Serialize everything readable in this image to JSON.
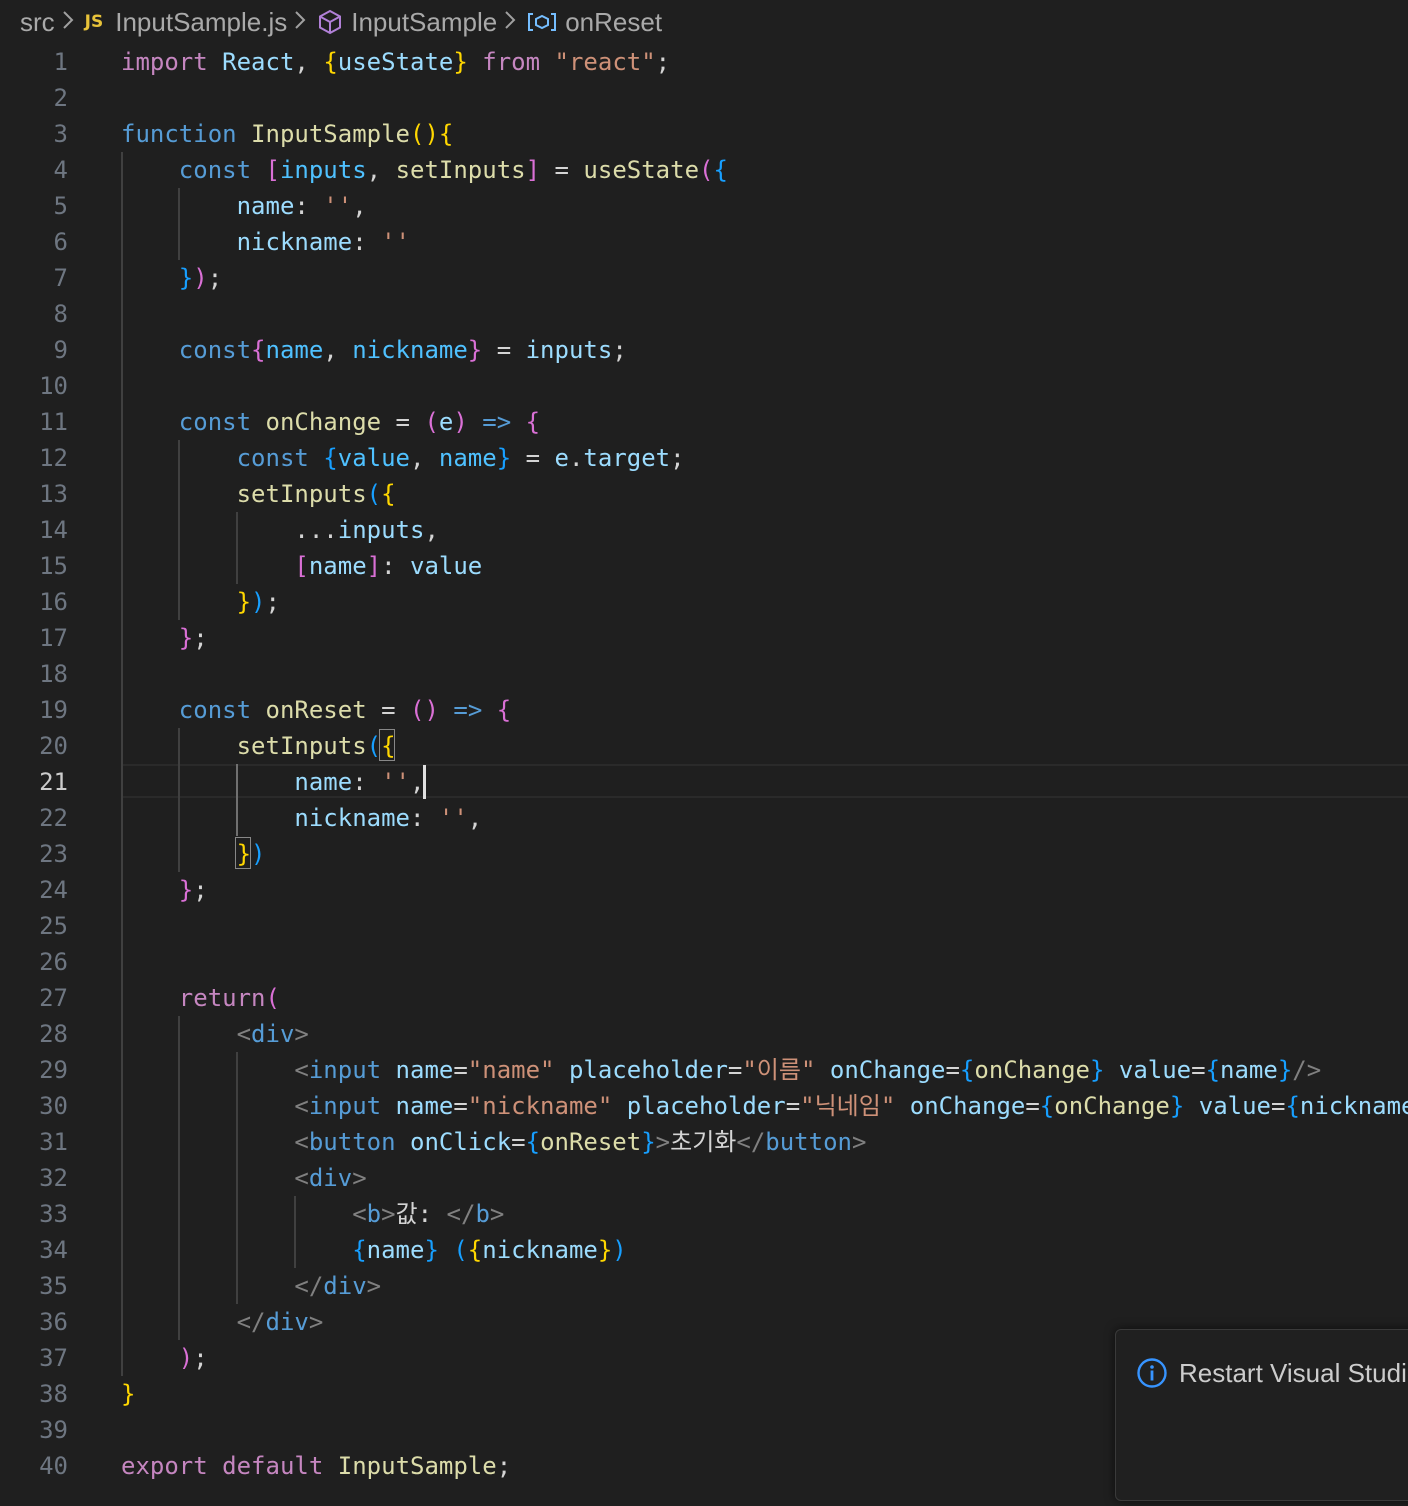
{
  "breadcrumb": {
    "folder": "src",
    "file_badge": "JS",
    "file": "InputSample.js",
    "component": "InputSample",
    "symbol": "onReset",
    "separator": ">"
  },
  "editor": {
    "active_line": 21,
    "lines": [
      [
        [
          "kc",
          "import"
        ],
        [
          "pn",
          " "
        ],
        [
          "vr",
          "React"
        ],
        [
          "pn",
          ", "
        ],
        [
          "b1",
          "{"
        ],
        [
          "vr",
          "useState"
        ],
        [
          "b1",
          "}"
        ],
        [
          "pn",
          " "
        ],
        [
          "kc",
          "from"
        ],
        [
          "pn",
          " "
        ],
        [
          "st",
          "\"react\""
        ],
        [
          "pn",
          ";"
        ]
      ],
      [],
      [
        [
          "kw",
          "function"
        ],
        [
          "pn",
          " "
        ],
        [
          "fn",
          "InputSample"
        ],
        [
          "b1",
          "()"
        ],
        [
          "b1",
          "{"
        ]
      ],
      [
        [
          "pn",
          "    "
        ],
        [
          "kw",
          "const"
        ],
        [
          "pn",
          " "
        ],
        [
          "b2",
          "["
        ],
        [
          "cn",
          "inputs"
        ],
        [
          "pn",
          ", "
        ],
        [
          "fn",
          "setInputs"
        ],
        [
          "b2",
          "]"
        ],
        [
          "pn",
          " = "
        ],
        [
          "fn",
          "useState"
        ],
        [
          "b2",
          "("
        ],
        [
          "b3",
          "{"
        ]
      ],
      [
        [
          "pn",
          "        "
        ],
        [
          "vr",
          "name"
        ],
        [
          "pn",
          ": "
        ],
        [
          "st",
          "''"
        ],
        [
          "pn",
          ","
        ]
      ],
      [
        [
          "pn",
          "        "
        ],
        [
          "vr",
          "nickname"
        ],
        [
          "pn",
          ": "
        ],
        [
          "st",
          "''"
        ]
      ],
      [
        [
          "pn",
          "    "
        ],
        [
          "b3",
          "}"
        ],
        [
          "b2",
          ")"
        ],
        [
          "pn",
          ";"
        ]
      ],
      [],
      [
        [
          "pn",
          "    "
        ],
        [
          "kw",
          "const"
        ],
        [
          "b2",
          "{"
        ],
        [
          "cn",
          "name"
        ],
        [
          "pn",
          ", "
        ],
        [
          "cn",
          "nickname"
        ],
        [
          "b2",
          "}"
        ],
        [
          "pn",
          " = "
        ],
        [
          "vr",
          "inputs"
        ],
        [
          "pn",
          ";"
        ]
      ],
      [],
      [
        [
          "pn",
          "    "
        ],
        [
          "kw",
          "const"
        ],
        [
          "pn",
          " "
        ],
        [
          "fn",
          "onChange"
        ],
        [
          "pn",
          " = "
        ],
        [
          "b2",
          "("
        ],
        [
          "vr",
          "e"
        ],
        [
          "b2",
          ")"
        ],
        [
          "pn",
          " "
        ],
        [
          "kw",
          "=>"
        ],
        [
          "pn",
          " "
        ],
        [
          "b2",
          "{"
        ]
      ],
      [
        [
          "pn",
          "        "
        ],
        [
          "kw",
          "const"
        ],
        [
          "pn",
          " "
        ],
        [
          "b3",
          "{"
        ],
        [
          "cn",
          "value"
        ],
        [
          "pn",
          ", "
        ],
        [
          "cn",
          "name"
        ],
        [
          "b3",
          "}"
        ],
        [
          "pn",
          " = "
        ],
        [
          "vr",
          "e"
        ],
        [
          "pn",
          "."
        ],
        [
          "vr",
          "target"
        ],
        [
          "pn",
          ";"
        ]
      ],
      [
        [
          "pn",
          "        "
        ],
        [
          "fn",
          "setInputs"
        ],
        [
          "b3",
          "("
        ],
        [
          "b1",
          "{"
        ]
      ],
      [
        [
          "pn",
          "            ..."
        ],
        [
          "vr",
          "inputs"
        ],
        [
          "pn",
          ","
        ]
      ],
      [
        [
          "pn",
          "            "
        ],
        [
          "b2",
          "["
        ],
        [
          "vr",
          "name"
        ],
        [
          "b2",
          "]"
        ],
        [
          "pn",
          ": "
        ],
        [
          "vr",
          "value"
        ]
      ],
      [
        [
          "pn",
          "        "
        ],
        [
          "b1",
          "}"
        ],
        [
          "b3",
          ")"
        ],
        [
          "pn",
          ";"
        ]
      ],
      [
        [
          "pn",
          "    "
        ],
        [
          "b2",
          "}"
        ],
        [
          "pn",
          ";"
        ]
      ],
      [],
      [
        [
          "pn",
          "    "
        ],
        [
          "kw",
          "const"
        ],
        [
          "pn",
          " "
        ],
        [
          "fn",
          "onReset"
        ],
        [
          "pn",
          " = "
        ],
        [
          "b2",
          "()"
        ],
        [
          "pn",
          " "
        ],
        [
          "kw",
          "=>"
        ],
        [
          "pn",
          " "
        ],
        [
          "b2",
          "{"
        ]
      ],
      [
        [
          "pn",
          "        "
        ],
        [
          "fn",
          "setInputs"
        ],
        [
          "b3",
          "("
        ],
        [
          "b1",
          "{"
        ]
      ],
      [
        [
          "pn",
          "            "
        ],
        [
          "vr",
          "name"
        ],
        [
          "pn",
          ": "
        ],
        [
          "st",
          "''"
        ],
        [
          "pn",
          ","
        ]
      ],
      [
        [
          "pn",
          "            "
        ],
        [
          "vr",
          "nickname"
        ],
        [
          "pn",
          ": "
        ],
        [
          "st",
          "''"
        ],
        [
          "pn",
          ","
        ]
      ],
      [
        [
          "pn",
          "        "
        ],
        [
          "b1",
          "}"
        ],
        [
          "b3",
          ")"
        ]
      ],
      [
        [
          "pn",
          "    "
        ],
        [
          "b2",
          "}"
        ],
        [
          "pn",
          ";"
        ]
      ],
      [],
      [],
      [
        [
          "pn",
          "    "
        ],
        [
          "kc",
          "return"
        ],
        [
          "b2",
          "("
        ]
      ],
      [
        [
          "pn",
          "        "
        ],
        [
          "tg",
          "<"
        ],
        [
          "tn",
          "div"
        ],
        [
          "tg",
          ">"
        ]
      ],
      [
        [
          "pn",
          "            "
        ],
        [
          "tg",
          "<"
        ],
        [
          "tn",
          "input"
        ],
        [
          "pn",
          " "
        ],
        [
          "vr",
          "name"
        ],
        [
          "pn",
          "="
        ],
        [
          "st",
          "\"name\""
        ],
        [
          "pn",
          " "
        ],
        [
          "vr",
          "placeholder"
        ],
        [
          "pn",
          "="
        ],
        [
          "st",
          "\"이름\""
        ],
        [
          "pn",
          " "
        ],
        [
          "vr",
          "onChange"
        ],
        [
          "pn",
          "="
        ],
        [
          "b3",
          "{"
        ],
        [
          "fn",
          "onChange"
        ],
        [
          "b3",
          "}"
        ],
        [
          "pn",
          " "
        ],
        [
          "vr",
          "value"
        ],
        [
          "pn",
          "="
        ],
        [
          "b3",
          "{"
        ],
        [
          "vr",
          "name"
        ],
        [
          "b3",
          "}"
        ],
        [
          "tg",
          "/>"
        ]
      ],
      [
        [
          "pn",
          "            "
        ],
        [
          "tg",
          "<"
        ],
        [
          "tn",
          "input"
        ],
        [
          "pn",
          " "
        ],
        [
          "vr",
          "name"
        ],
        [
          "pn",
          "="
        ],
        [
          "st",
          "\"nickname\""
        ],
        [
          "pn",
          " "
        ],
        [
          "vr",
          "placeholder"
        ],
        [
          "pn",
          "="
        ],
        [
          "st",
          "\"닉네임\""
        ],
        [
          "pn",
          " "
        ],
        [
          "vr",
          "onChange"
        ],
        [
          "pn",
          "="
        ],
        [
          "b3",
          "{"
        ],
        [
          "fn",
          "onChange"
        ],
        [
          "b3",
          "}"
        ],
        [
          "pn",
          " "
        ],
        [
          "vr",
          "value"
        ],
        [
          "pn",
          "="
        ],
        [
          "b3",
          "{"
        ],
        [
          "vr",
          "nickname"
        ],
        [
          "b3",
          "}"
        ],
        [
          "tg",
          "/>"
        ]
      ],
      [
        [
          "pn",
          "            "
        ],
        [
          "tg",
          "<"
        ],
        [
          "tn",
          "button"
        ],
        [
          "pn",
          " "
        ],
        [
          "vr",
          "onClick"
        ],
        [
          "pn",
          "="
        ],
        [
          "b3",
          "{"
        ],
        [
          "fn",
          "onReset"
        ],
        [
          "b3",
          "}"
        ],
        [
          "tg",
          ">"
        ],
        [
          "tx",
          "초기화"
        ],
        [
          "tg",
          "</"
        ],
        [
          "tn",
          "button"
        ],
        [
          "tg",
          ">"
        ]
      ],
      [
        [
          "pn",
          "            "
        ],
        [
          "tg",
          "<"
        ],
        [
          "tn",
          "div"
        ],
        [
          "tg",
          ">"
        ]
      ],
      [
        [
          "pn",
          "                "
        ],
        [
          "tg",
          "<"
        ],
        [
          "tn",
          "b"
        ],
        [
          "tg",
          ">"
        ],
        [
          "tx",
          "값: "
        ],
        [
          "tg",
          "</"
        ],
        [
          "tn",
          "b"
        ],
        [
          "tg",
          ">"
        ]
      ],
      [
        [
          "pn",
          "                "
        ],
        [
          "b3",
          "{"
        ],
        [
          "vr",
          "name"
        ],
        [
          "b3",
          "}"
        ],
        [
          "tx",
          " "
        ],
        [
          "b3",
          "("
        ],
        [
          "b1",
          "{"
        ],
        [
          "vr",
          "nickname"
        ],
        [
          "b1",
          "}"
        ],
        [
          "b3",
          ")"
        ]
      ],
      [
        [
          "pn",
          "            "
        ],
        [
          "tg",
          "</"
        ],
        [
          "tn",
          "div"
        ],
        [
          "tg",
          ">"
        ]
      ],
      [
        [
          "pn",
          "        "
        ],
        [
          "tg",
          "</"
        ],
        [
          "tn",
          "div"
        ],
        [
          "tg",
          ">"
        ]
      ],
      [
        [
          "pn",
          "    "
        ],
        [
          "b2",
          ")"
        ],
        [
          "pn",
          ";"
        ]
      ],
      [
        [
          "b1",
          "}"
        ]
      ],
      [],
      [
        [
          "kc",
          "export"
        ],
        [
          "pn",
          " "
        ],
        [
          "kc",
          "default"
        ],
        [
          "pn",
          " "
        ],
        [
          "fn",
          "InputSample"
        ],
        [
          "pn",
          ";"
        ]
      ]
    ]
  },
  "notification": {
    "message": "Restart Visual Studio Code to apply the update"
  },
  "icons": {
    "info": "info-circle-icon",
    "component": "cube-icon",
    "symbol": "variable-symbol-icon"
  },
  "colors": {
    "background": "#1f1f1f",
    "keyword": "#569cd6",
    "control": "#c586c0",
    "function": "#dcdcaa",
    "variable": "#9cdcfe",
    "string": "#ce9178",
    "bracket_gold": "#ffd700",
    "bracket_orchid": "#da70d6",
    "bracket_blue": "#179fff"
  }
}
